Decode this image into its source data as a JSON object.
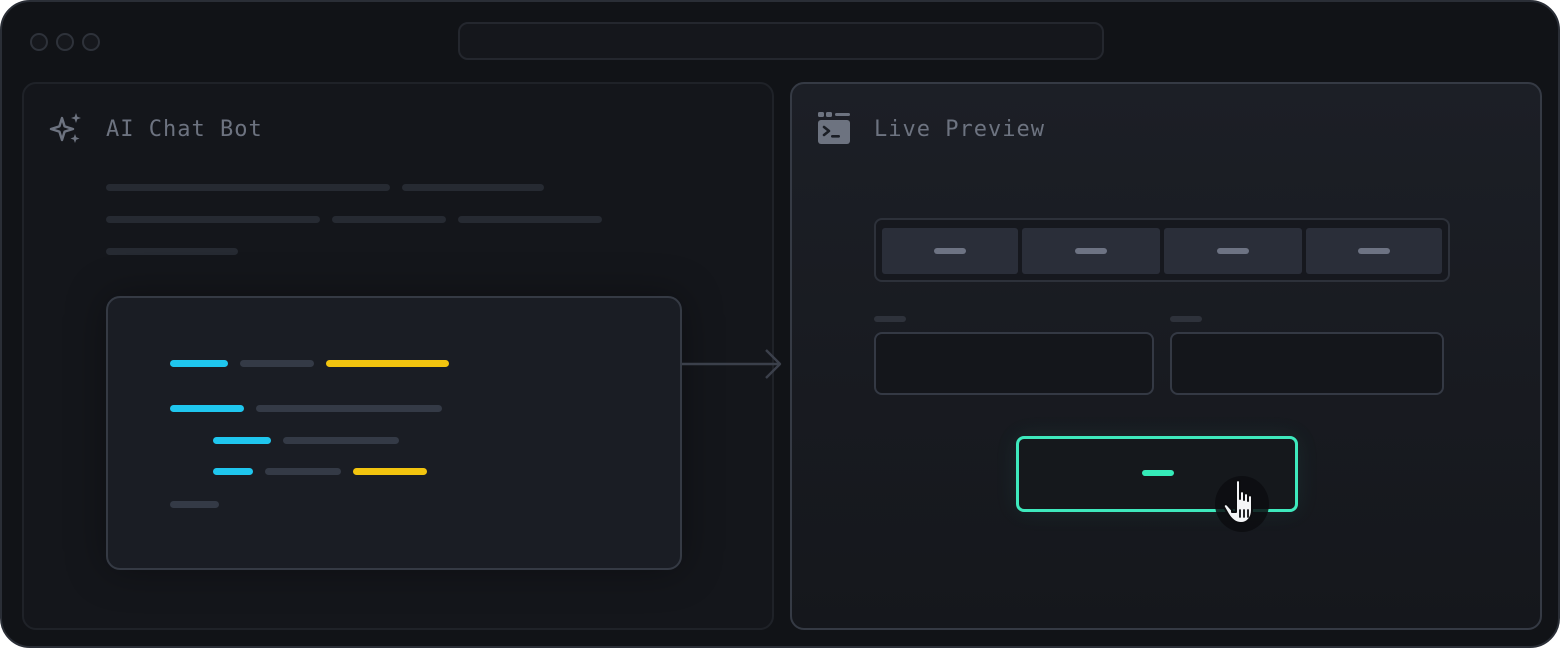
{
  "window": {
    "controls": [
      "close",
      "minimize",
      "maximize"
    ]
  },
  "left_panel": {
    "title": "AI Chat Bot",
    "icon": "sparkles-icon"
  },
  "right_panel": {
    "title": "Live Preview",
    "icon": "terminal-window-icon"
  },
  "colors": {
    "background": "#111317",
    "code_keyword": "#1fc6ee",
    "code_string": "#f2c40f",
    "accent_button": "#3ee9bd",
    "muted_text": "#6d7380"
  },
  "preview": {
    "tab_count": 4,
    "field_count": 2
  },
  "cursor": {
    "icon": "hand-pointer-icon"
  }
}
